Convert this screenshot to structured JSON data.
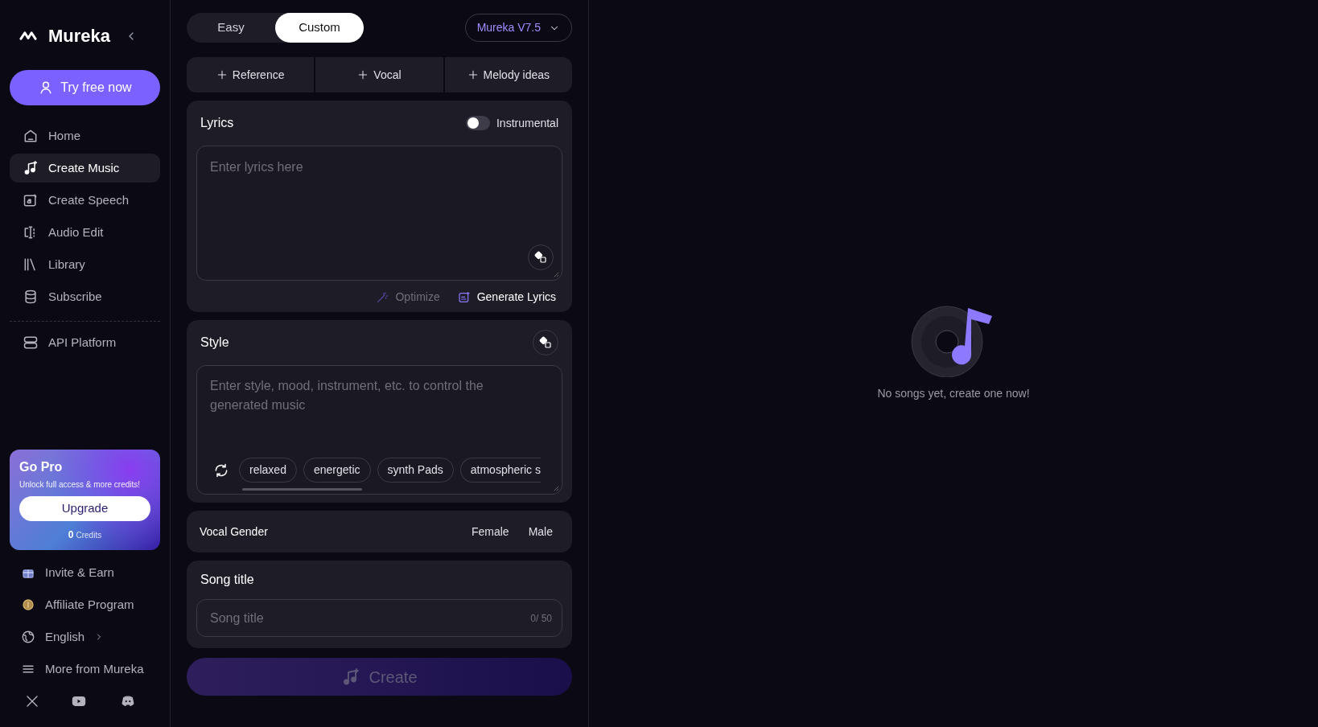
{
  "sidebar": {
    "logo": "Mureka",
    "try_button": "Try free now",
    "nav": [
      {
        "label": "Home",
        "kind": "home",
        "selected": false
      },
      {
        "label": "Create Music",
        "kind": "music",
        "selected": true
      },
      {
        "label": "Create Speech",
        "kind": "speech",
        "selected": false
      },
      {
        "label": "Audio Edit",
        "kind": "edit",
        "selected": false
      },
      {
        "label": "Library",
        "kind": "library",
        "selected": false
      },
      {
        "label": "Subscribe",
        "kind": "database",
        "selected": false
      },
      {
        "label": "API Platform",
        "kind": "server",
        "selected": false
      }
    ],
    "promo": {
      "title": "Go Pro",
      "subtitle": "Unlock full access & more credits!",
      "button": "Upgrade",
      "credits_count": "0",
      "credits_label": "Credits"
    },
    "extras": [
      {
        "label": "Invite & Earn",
        "kind": "gift"
      },
      {
        "label": "Affiliate Program",
        "kind": "coin"
      },
      {
        "label": "English",
        "kind": "globe"
      },
      {
        "label": "More from Mureka",
        "kind": "menu"
      }
    ]
  },
  "mode_tabs": [
    {
      "label": "Easy",
      "selected": false
    },
    {
      "label": "Custom",
      "selected": true
    }
  ],
  "model_select": "Mureka V7.5",
  "add_buttons": [
    "Reference",
    "Vocal",
    "Melody ideas"
  ],
  "lyrics": {
    "title": "Lyrics",
    "instrumental": {
      "label": "Instrumental",
      "on": false
    },
    "placeholder": "Enter lyrics here",
    "actions": [
      {
        "label": "Optimize",
        "disabled": true
      },
      {
        "label": "Generate Lyrics",
        "disabled": false
      }
    ]
  },
  "style": {
    "title": "Style",
    "placeholder": "Enter style, mood, instrument, etc. to control the generated music",
    "tags": [
      "relaxed",
      "energetic",
      "synth Pads",
      "atmospheric s"
    ]
  },
  "vocal_gender": {
    "label": "Vocal Gender",
    "options": [
      {
        "label": "Female",
        "selected": false
      },
      {
        "label": "Male",
        "selected": false
      }
    ]
  },
  "song_title": {
    "title": "Song title",
    "placeholder": "Song title",
    "counter": "0/ 50"
  },
  "create_button": {
    "label": "Create",
    "disabled": true
  },
  "empty_state": {
    "message": "No songs yet, create one now!"
  }
}
